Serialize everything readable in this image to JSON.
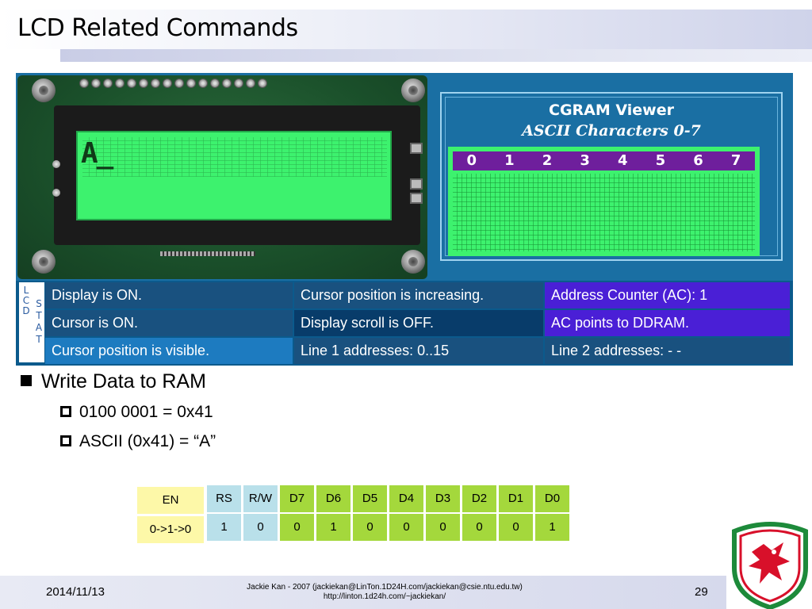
{
  "slide": {
    "title": "LCD Related Commands",
    "date": "2014/11/13",
    "credit_line1": "Jackie Kan - 2007 (jackiekan@LinTon.1D24H.com/jackiekan@csie.ntu.edu.tw)",
    "credit_line2": "http://linton.1d24h.com/~jackiekan/",
    "page_number": "29"
  },
  "lcd": {
    "display_char": "A_"
  },
  "cgram": {
    "title": "CGRAM Viewer",
    "subtitle": "ASCII Characters 0-7",
    "columns": [
      "0",
      "1",
      "2",
      "3",
      "4",
      "5",
      "6",
      "7"
    ]
  },
  "status": {
    "lcd_label": [
      "L",
      "C",
      "D"
    ],
    "stat_label": [
      "S",
      "T",
      "A",
      "T"
    ],
    "rows": [
      [
        "Display is ON.",
        "Cursor position is increasing.",
        "Address Counter (AC): 1"
      ],
      [
        "Cursor is ON.",
        "Display scroll is OFF.",
        "AC points to DDRAM."
      ],
      [
        "Cursor position is visible.",
        "Line 1 addresses: 0..15",
        "Line 2 addresses: - -"
      ]
    ]
  },
  "bullets": {
    "main": "Write Data to RAM",
    "sub": [
      "0100 0001 = 0x41",
      "ASCII (0x41) = “A”"
    ]
  },
  "bit_table": {
    "en_header": "EN",
    "en_value": "0->1->0",
    "headers": [
      "RS",
      "R/W",
      "D7",
      "D6",
      "D5",
      "D4",
      "D3",
      "D2",
      "D1",
      "D0"
    ],
    "values": [
      "1",
      "0",
      "0",
      "1",
      "0",
      "0",
      "0",
      "0",
      "0",
      "1"
    ]
  },
  "colors": {
    "lcd_green": "#3df26e",
    "cgram_header_purple": "#6e1f9c",
    "status_purple": "#4a1fd6",
    "bit_yellow": "#fdf8a8",
    "bit_blue": "#b9e0ea",
    "bit_green": "#a4d83c",
    "logo_red": "#d8102a"
  }
}
